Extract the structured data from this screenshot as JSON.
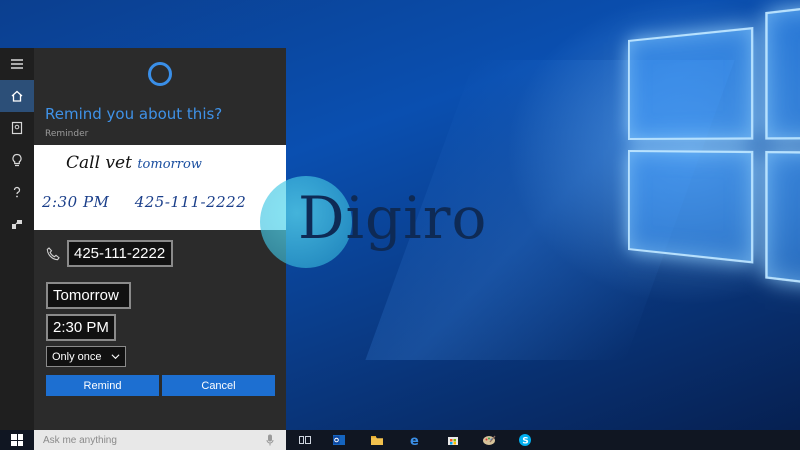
{
  "cortana": {
    "prompt": "Remind you about this?",
    "section_label": "Reminder",
    "ink_note": {
      "line1_main": "Call vet",
      "line1_extra": "tomorrow",
      "line2_time": "2:30 PM",
      "line2_phone": "425-111-2222"
    },
    "phone_value": "425-111-2222",
    "date_value": "Tomorrow",
    "time_value": "2:30 PM",
    "repeat_value": "Only once",
    "remind_label": "Remind",
    "cancel_label": "Cancel"
  },
  "rail": {
    "icons": [
      "menu-icon",
      "home-icon",
      "notebook-icon",
      "lightbulb-icon",
      "help-icon",
      "feedback-icon"
    ],
    "active": "home-icon"
  },
  "taskbar": {
    "search_placeholder": "Ask me anything",
    "pinned": [
      "task-view-icon",
      "outlook-icon",
      "file-explorer-icon",
      "edge-icon",
      "store-icon",
      "paint-icon",
      "skype-icon"
    ]
  },
  "watermark": {
    "text": "Digiro"
  },
  "colors": {
    "accent": "#1d6fd1",
    "prompt": "#3f92e8",
    "panel_bg": "#2b2b2b",
    "rail_bg": "#1f1f1f",
    "taskbar_bg": "#101622"
  }
}
